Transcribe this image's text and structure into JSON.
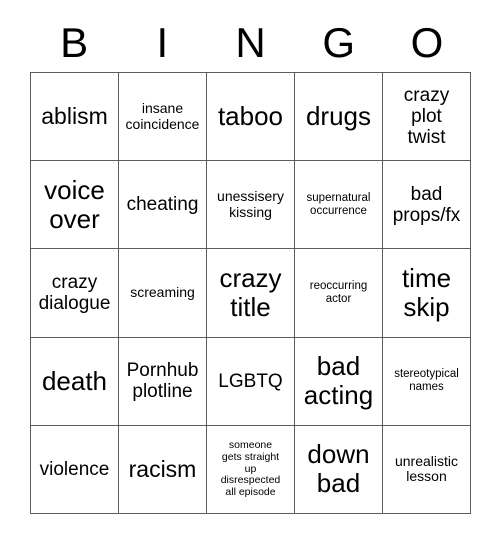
{
  "card": {
    "type": "bingo-card",
    "header_letters": [
      "B",
      "I",
      "N",
      "G",
      "O"
    ],
    "grid_size": "5x5",
    "colors": {
      "background": "#ffffff",
      "text": "#000000",
      "border": "#5c5c5c"
    },
    "rows": [
      [
        {
          "text": "ablism",
          "size": "lg"
        },
        {
          "text": "insane\ncoincidence",
          "size": "sm"
        },
        {
          "text": "taboo",
          "size": "xl"
        },
        {
          "text": "drugs",
          "size": "xl"
        },
        {
          "text": "crazy\nplot\ntwist",
          "size": "md"
        }
      ],
      [
        {
          "text": "voice\nover",
          "size": "xl"
        },
        {
          "text": "cheating",
          "size": "md"
        },
        {
          "text": "unessisery\nkissing",
          "size": "sm"
        },
        {
          "text": "supernatural\noccurrence",
          "size": "xs"
        },
        {
          "text": "bad\nprops/fx",
          "size": "md"
        }
      ],
      [
        {
          "text": "crazy\ndialogue",
          "size": "md"
        },
        {
          "text": "screaming",
          "size": "sm"
        },
        {
          "text": "crazy\ntitle",
          "size": "xl"
        },
        {
          "text": "reoccurring\nactor",
          "size": "xs"
        },
        {
          "text": "time\nskip",
          "size": "xl"
        }
      ],
      [
        {
          "text": "death",
          "size": "xl"
        },
        {
          "text": "Pornhub\nplotline",
          "size": "md"
        },
        {
          "text": "LGBTQ",
          "size": "md"
        },
        {
          "text": "bad\nacting",
          "size": "xl"
        },
        {
          "text": "stereotypical\nnames",
          "size": "xs"
        }
      ],
      [
        {
          "text": "violence",
          "size": "md"
        },
        {
          "text": "racism",
          "size": "lg"
        },
        {
          "text": "someone\ngets straight\nup\ndisrespected\nall episode",
          "size": "xxs"
        },
        {
          "text": "down\nbad",
          "size": "xl"
        },
        {
          "text": "unrealistic\nlesson",
          "size": "sm"
        }
      ]
    ]
  }
}
